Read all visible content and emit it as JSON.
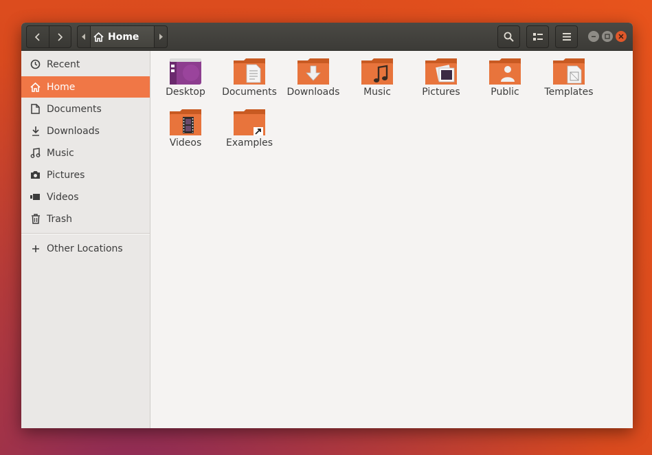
{
  "navigation": {
    "back": "back",
    "forward": "forward"
  },
  "path": {
    "current": "Home"
  },
  "sidebar": {
    "items": [
      {
        "label": "Recent",
        "icon": "clock-icon"
      },
      {
        "label": "Home",
        "icon": "home-icon",
        "active": true
      },
      {
        "label": "Documents",
        "icon": "document-icon"
      },
      {
        "label": "Downloads",
        "icon": "download-icon"
      },
      {
        "label": "Music",
        "icon": "music-icon"
      },
      {
        "label": "Pictures",
        "icon": "camera-icon"
      },
      {
        "label": "Videos",
        "icon": "video-icon"
      },
      {
        "label": "Trash",
        "icon": "trash-icon"
      }
    ],
    "other": {
      "label": "Other Locations",
      "icon": "plus-icon"
    }
  },
  "files": [
    {
      "label": "Desktop",
      "icon": "desktop-folder-icon"
    },
    {
      "label": "Documents",
      "icon": "documents-folder-icon"
    },
    {
      "label": "Downloads",
      "icon": "downloads-folder-icon"
    },
    {
      "label": "Music",
      "icon": "music-folder-icon"
    },
    {
      "label": "Pictures",
      "icon": "pictures-folder-icon"
    },
    {
      "label": "Public",
      "icon": "public-folder-icon"
    },
    {
      "label": "Templates",
      "icon": "templates-folder-icon"
    },
    {
      "label": "Videos",
      "icon": "videos-folder-icon"
    },
    {
      "label": "Examples",
      "icon": "examples-folder-icon"
    }
  ],
  "colors": {
    "accent": "#f07746",
    "folder": "#e8743c",
    "headerbar": "#3c3b37",
    "desktop": "#8d3d8f"
  }
}
